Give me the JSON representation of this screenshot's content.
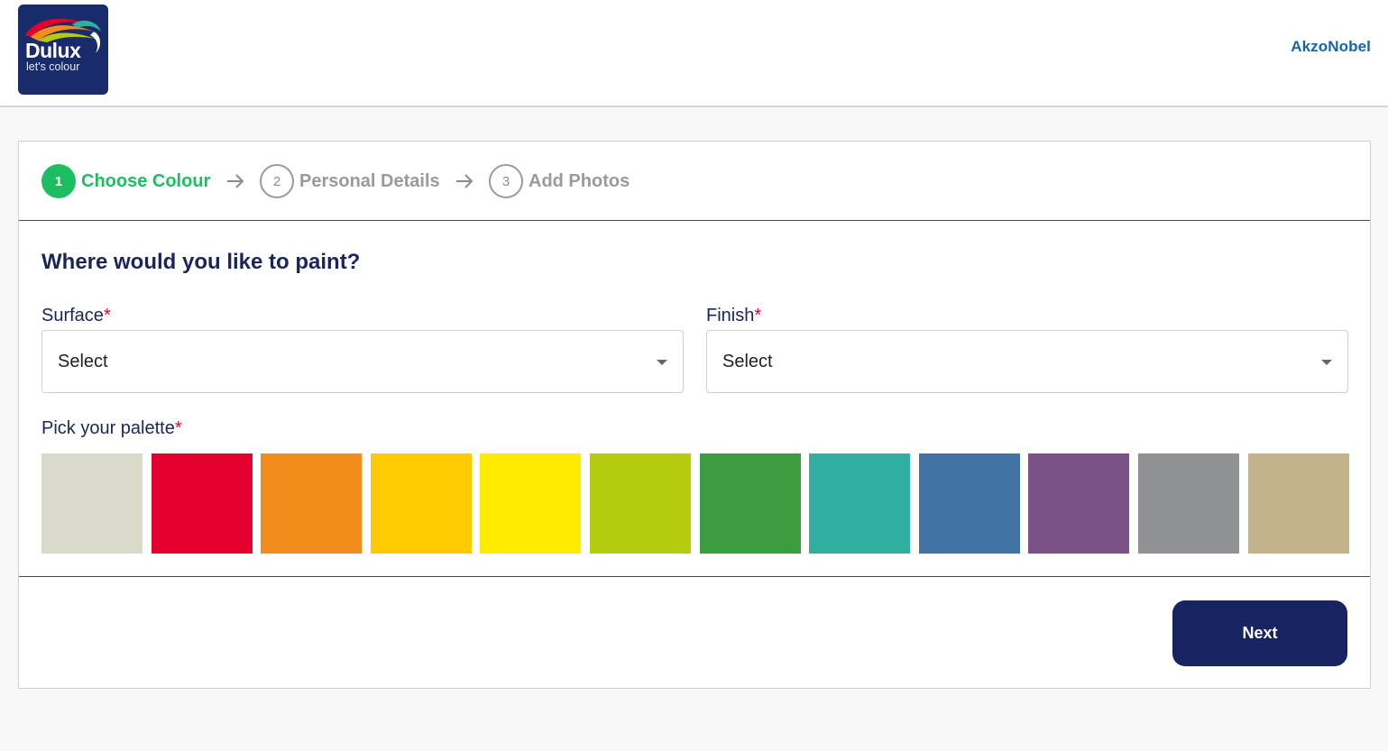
{
  "brand": {
    "logo_word": "Dulux",
    "logo_tagline": "let's colour",
    "partner": "AkzoNobel"
  },
  "steps": [
    {
      "number": "1",
      "label": "Choose Colour",
      "state": "active"
    },
    {
      "number": "2",
      "label": "Personal Details",
      "state": "inactive"
    },
    {
      "number": "3",
      "label": "Add Photos",
      "state": "inactive"
    }
  ],
  "form": {
    "question": "Where would you like to paint?",
    "surface": {
      "label": "Surface",
      "required_mark": "*",
      "value": "Select"
    },
    "finish": {
      "label": "Finish",
      "required_mark": "*",
      "value": "Select"
    },
    "palette": {
      "label": "Pick your palette",
      "required_mark": "*",
      "colors": [
        "#dadacb",
        "#e4002f",
        "#f28c1b",
        "#ffcb00",
        "#ffeb00",
        "#b5cc0e",
        "#3f9b40",
        "#2eaf9f",
        "#4174a3",
        "#7a5285",
        "#8f9192",
        "#c2b38d"
      ]
    }
  },
  "actions": {
    "next_label": "Next"
  },
  "colors": {
    "accent_green": "#1dbe62",
    "navy": "#172461",
    "required_red": "#e4002b"
  }
}
